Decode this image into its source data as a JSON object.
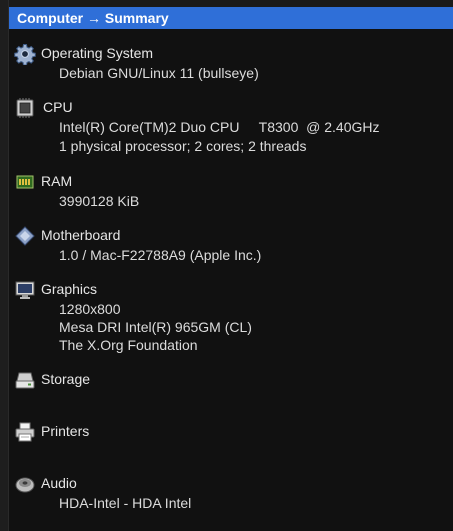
{
  "header": {
    "title": "Computer → Summary"
  },
  "sections": [
    {
      "title": "Operating System",
      "icon": "gear-icon",
      "lines": [
        "Debian GNU/Linux 11 (bullseye)"
      ]
    },
    {
      "title": "CPU",
      "icon": "cpu-chip-icon",
      "lines": [
        "Intel(R) Core(TM)2 Duo CPU     T8300  @ 2.40GHz",
        "1 physical processor; 2 cores; 2 threads"
      ]
    },
    {
      "title": "RAM",
      "icon": "memory-icon",
      "lines": [
        "3990128 KiB"
      ]
    },
    {
      "title": "Motherboard",
      "icon": "motherboard-icon",
      "lines": [
        "1.0 / Mac-F22788A9 (Apple Inc.)"
      ]
    },
    {
      "title": "Graphics",
      "icon": "monitor-icon",
      "lines": [
        "1280x800",
        "Mesa DRI Intel(R) 965GM (CL)",
        "The X.Org Foundation"
      ]
    },
    {
      "title": "Storage",
      "icon": "drive-icon",
      "lines": []
    },
    {
      "title": "Printers",
      "icon": "printer-icon",
      "lines": []
    },
    {
      "title": "Audio",
      "icon": "speaker-icon",
      "lines": [
        "HDA-Intel - HDA Intel"
      ]
    }
  ]
}
